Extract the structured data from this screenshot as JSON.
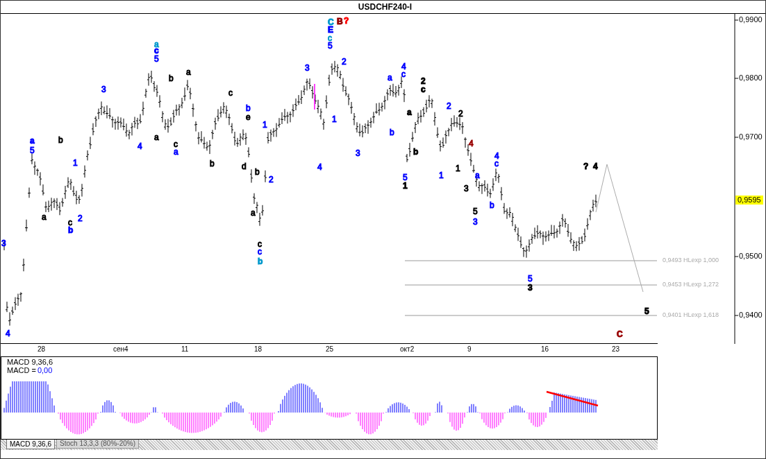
{
  "window": {
    "title": "USDCHF240-I"
  },
  "price_axis": {
    "labels": [
      "0,9900",
      "0,9800",
      "0,9700",
      "0,9500",
      "0,9400"
    ],
    "current_price": "0,9595"
  },
  "date_axis": {
    "labels": [
      "28",
      "сен4",
      "11",
      "18",
      "25",
      "окт2",
      "9",
      "16",
      "23"
    ]
  },
  "levels": [
    {
      "label": "0,9493 HLexp 1,000"
    },
    {
      "label": "0,9453 HLexp 1,272"
    },
    {
      "label": "0,9401 HLexp 1,618"
    }
  ],
  "wave_labels": [
    {
      "text": "3",
      "color": "#0000ff",
      "bold": false
    },
    {
      "text": "4",
      "color": "#0000ff",
      "bold": false
    },
    {
      "text": "a",
      "color": "#0000ff",
      "bold": true
    },
    {
      "text": "5",
      "color": "#0000ff",
      "bold": false
    },
    {
      "text": "b",
      "color": "#000000",
      "bold": false
    },
    {
      "text": "1",
      "color": "#0000ff",
      "bold": false
    },
    {
      "text": "a",
      "color": "#000000",
      "bold": false
    },
    {
      "text": "c",
      "color": "#000000",
      "bold": false
    },
    {
      "text": "b",
      "color": "#0000ff",
      "bold": true
    },
    {
      "text": "2",
      "color": "#0000ff",
      "bold": false
    },
    {
      "text": "3",
      "color": "#0000ff",
      "bold": false
    },
    {
      "text": "4",
      "color": "#0000ff",
      "bold": false
    },
    {
      "text": "a",
      "color": "#0099cc",
      "bold": false
    },
    {
      "text": "c",
      "color": "#0000ff",
      "bold": true
    },
    {
      "text": "5",
      "color": "#0000ff",
      "bold": false
    },
    {
      "text": "b",
      "color": "#000000",
      "bold": false
    },
    {
      "text": "a",
      "color": "#000000",
      "bold": false
    },
    {
      "text": "a",
      "color": "#000000",
      "bold": false
    },
    {
      "text": "c",
      "color": "#000000",
      "bold": false
    },
    {
      "text": "a",
      "color": "#0000ff",
      "bold": false
    },
    {
      "text": "c",
      "color": "#000000",
      "bold": false
    },
    {
      "text": "b",
      "color": "#000000",
      "bold": false
    },
    {
      "text": "b",
      "color": "#0000ff",
      "bold": false
    },
    {
      "text": "e",
      "color": "#000000",
      "bold": false
    },
    {
      "text": "d",
      "color": "#000000",
      "bold": false
    },
    {
      "text": "1",
      "color": "#0000ff",
      "bold": false
    },
    {
      "text": "b",
      "color": "#000000",
      "bold": false
    },
    {
      "text": "2",
      "color": "#0000ff",
      "bold": false
    },
    {
      "text": "a",
      "color": "#000000",
      "bold": false
    },
    {
      "text": "c",
      "color": "#000000",
      "bold": false
    },
    {
      "text": "c",
      "color": "#0000ff",
      "bold": false
    },
    {
      "text": "b",
      "color": "#0099cc",
      "bold": true
    },
    {
      "text": "3",
      "color": "#0000ff",
      "bold": false
    },
    {
      "text": "4",
      "color": "#0000ff",
      "bold": false
    },
    {
      "text": "C",
      "color": "#0099cc",
      "bold": true
    },
    {
      "text": "E",
      "color": "#0000ff",
      "bold": true
    },
    {
      "text": "c",
      "color": "#0099cc",
      "bold": false
    },
    {
      "text": "5",
      "color": "#0000ff",
      "bold": false
    },
    {
      "text": "B",
      "color": "#990000",
      "bold": true
    },
    {
      "text": "?",
      "color": "#ff0000",
      "bold": true
    },
    {
      "text": "2",
      "color": "#0000ff",
      "bold": false
    },
    {
      "text": "1",
      "color": "#0000ff",
      "bold": false
    },
    {
      "text": "3",
      "color": "#0000ff",
      "bold": false
    },
    {
      "text": "a",
      "color": "#0000ff",
      "bold": false
    },
    {
      "text": "4",
      "color": "#0000ff",
      "bold": false
    },
    {
      "text": "c",
      "color": "#0000ff",
      "bold": false
    },
    {
      "text": "b",
      "color": "#0000ff",
      "bold": false
    },
    {
      "text": "2",
      "color": "#000000",
      "bold": true
    },
    {
      "text": "c",
      "color": "#000000",
      "bold": true
    },
    {
      "text": "a",
      "color": "#000000",
      "bold": true
    },
    {
      "text": "b",
      "color": "#000000",
      "bold": true
    },
    {
      "text": "5",
      "color": "#0000ff",
      "bold": false
    },
    {
      "text": "1",
      "color": "#000000",
      "bold": true
    },
    {
      "text": "2",
      "color": "#0000ff",
      "bold": false
    },
    {
      "text": "2",
      "color": "#000000",
      "bold": false
    },
    {
      "text": "1",
      "color": "#0000ff",
      "bold": false
    },
    {
      "text": "1",
      "color": "#000000",
      "bold": false
    },
    {
      "text": "4",
      "color": "#990000",
      "bold": false
    },
    {
      "text": "3",
      "color": "#000000",
      "bold": false
    },
    {
      "text": "a",
      "color": "#0000ff",
      "bold": false
    },
    {
      "text": "5",
      "color": "#000000",
      "bold": false
    },
    {
      "text": "b",
      "color": "#0000ff",
      "bold": false
    },
    {
      "text": "3",
      "color": "#0000ff",
      "bold": false
    },
    {
      "text": "4",
      "color": "#0000ff",
      "bold": false
    },
    {
      "text": "c",
      "color": "#0000ff",
      "bold": false
    },
    {
      "text": "5",
      "color": "#0000ff",
      "bold": false
    },
    {
      "text": "3",
      "color": "#000000",
      "bold": true
    },
    {
      "text": "?",
      "color": "#000000",
      "bold": true
    },
    {
      "text": "4",
      "color": "#000000",
      "bold": true
    },
    {
      "text": "5",
      "color": "#000000",
      "bold": true
    },
    {
      "text": "C",
      "color": "#990000",
      "bold": true
    }
  ],
  "macd": {
    "title": "MACD 9,36,6",
    "value_label": "MACD =",
    "value": "0,00"
  },
  "indicator_tabs": [
    {
      "label": "MACD 9,36,6",
      "selected": true
    },
    {
      "label": "Stoch 13,3,3 (80%-20%)",
      "selected": false
    }
  ]
}
